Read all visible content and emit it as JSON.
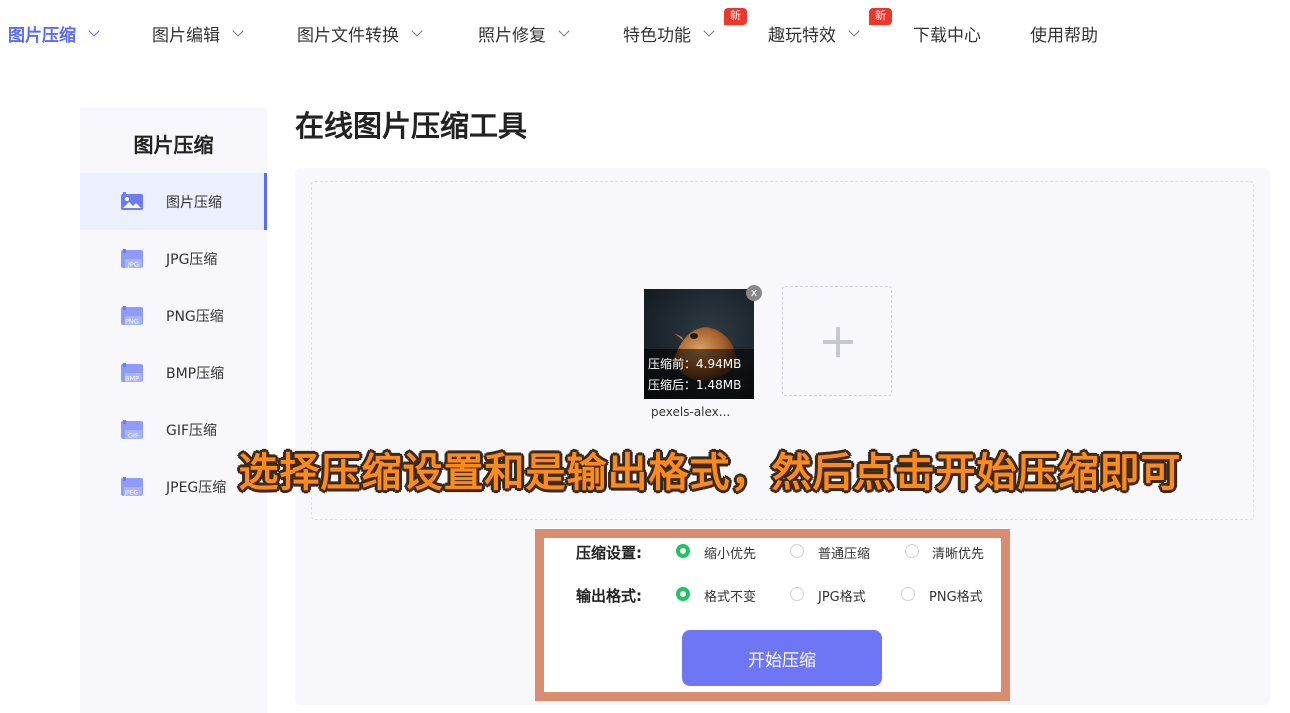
{
  "nav": {
    "items": [
      {
        "label": "图片压缩",
        "has_dropdown": true,
        "active": true,
        "badge": ""
      },
      {
        "label": "图片编辑",
        "has_dropdown": true,
        "active": false,
        "badge": ""
      },
      {
        "label": "图片文件转换",
        "has_dropdown": true,
        "active": false,
        "badge": ""
      },
      {
        "label": "照片修复",
        "has_dropdown": true,
        "active": false,
        "badge": ""
      },
      {
        "label": "特色功能",
        "has_dropdown": true,
        "active": false,
        "badge": "新"
      },
      {
        "label": "趣玩特效",
        "has_dropdown": true,
        "active": false,
        "badge": "新"
      },
      {
        "label": "下载中心",
        "has_dropdown": false,
        "active": false,
        "badge": ""
      },
      {
        "label": "使用帮助",
        "has_dropdown": false,
        "active": false,
        "badge": ""
      }
    ]
  },
  "sidebar": {
    "title": "图片压缩",
    "items": [
      {
        "label": "图片压缩",
        "icon": "image-icon",
        "icon_text": "",
        "active": true
      },
      {
        "label": "JPG压缩",
        "icon": "jpg-file-icon",
        "icon_text": "JPG",
        "active": false
      },
      {
        "label": "PNG压缩",
        "icon": "png-file-icon",
        "icon_text": "PNG",
        "active": false
      },
      {
        "label": "BMP压缩",
        "icon": "bmp-file-icon",
        "icon_text": "BMP",
        "active": false
      },
      {
        "label": "GIF压缩",
        "icon": "gif-file-icon",
        "icon_text": "GIF",
        "active": false
      },
      {
        "label": "JPEG压缩",
        "icon": "jpeg-file-icon",
        "icon_text": "JPEG",
        "active": false
      }
    ]
  },
  "main": {
    "title": "在线图片压缩工具",
    "file": {
      "name": "pexels-alex...",
      "before": "压缩前：4.94MB",
      "after": "压缩后：1.48MB",
      "remove_label": "x"
    },
    "caption": "选择压缩设置和是输出格式，然后点击开始压缩即可",
    "settings": {
      "compress_label": "压缩设置:",
      "compress_options": [
        "缩小优先",
        "普通压缩",
        "清晰优先"
      ],
      "compress_selected": 0,
      "format_label": "输出格式:",
      "format_options": [
        "格式不变",
        "JPG格式",
        "PNG格式"
      ],
      "format_selected": 0
    },
    "start_button": "开始压缩"
  },
  "colors": {
    "accent": "#5b6bf5",
    "button": "#6e76f6",
    "radio_on": "#1ec464",
    "badge": "#f0352b",
    "caption": "#ff8a1c",
    "highlight_border": "#d98d6f"
  }
}
